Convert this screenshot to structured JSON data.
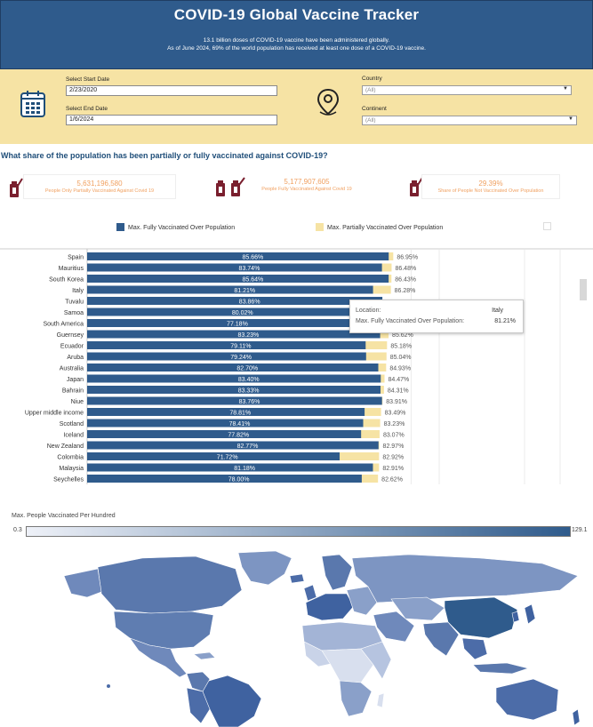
{
  "header": {
    "title": "COVID-19 Global Vaccine Tracker",
    "line1": "13.1 billion doses of COVID-19 vaccine have been administered globally.",
    "line2": "As of June 2024, 69% of the world population has received at least one dose of a COVID-19 vaccine."
  },
  "filters": {
    "start_label": "Select Start Date",
    "start_value": "2/23/2020",
    "end_label": "Select End Date",
    "end_value": "1/6/2024",
    "country_label": "Country",
    "country_value": "(All)",
    "continent_label": "Continent",
    "continent_value": "(All)"
  },
  "question": "What share of the population has been partially or fully vaccinated against COVID-19?",
  "kpis": [
    {
      "value": "5,631,196,580",
      "label": "People Only Partially Vaccinated Against Covid 19"
    },
    {
      "value": "5,177,907,605",
      "label": "People Fully Vaccinated Against Covid 19"
    },
    {
      "value": "29.39%",
      "label": "Share of People Not Vaccinated Over Population"
    }
  ],
  "legend": {
    "fully": "Max. Fully Vaccinated Over Population",
    "partial": "Max. Partially Vaccinated Over Population"
  },
  "colors": {
    "fully": "#2f5b8c",
    "partial": "#f6e3a4",
    "header": "#2f5b8c",
    "filters_bg": "#f6e3a4",
    "kpi_icon": "#7a1f2e"
  },
  "chart_data": {
    "type": "bar",
    "orientation": "horizontal",
    "stacked": false,
    "xlim": [
      0,
      100
    ],
    "categories": [
      "Spain",
      "Mauritius",
      "South Korea",
      "Italy",
      "Tuvalu",
      "Samoa",
      "South America",
      "Guernsey",
      "Ecuador",
      "Aruba",
      "Australia",
      "Japan",
      "Bahrain",
      "Niue",
      "Upper middle income",
      "Scotland",
      "Iceland",
      "New Zealand",
      "Colombia",
      "Malaysia",
      "Seychelles"
    ],
    "series": [
      {
        "name": "Max. Fully Vaccinated Over Population",
        "values": [
          85.66,
          83.74,
          85.64,
          81.21,
          83.86,
          80.02,
          77.18,
          83.23,
          79.11,
          79.24,
          82.7,
          83.4,
          83.33,
          83.76,
          78.81,
          78.41,
          77.82,
          82.77,
          71.72,
          81.18,
          78.0
        ]
      },
      {
        "name": "Max. Partially Vaccinated Over Population",
        "values": [
          86.95,
          86.48,
          86.43,
          86.28,
          null,
          null,
          null,
          85.62,
          85.18,
          85.04,
          84.93,
          84.47,
          84.31,
          83.91,
          83.49,
          83.23,
          83.07,
          82.97,
          82.92,
          82.91,
          82.62
        ]
      }
    ],
    "fully_labels": [
      "85.66%",
      "83.74%",
      "85.64%",
      "81.21%",
      "83.86%",
      "80.02%",
      "77.18%",
      "83.23%",
      "79.11%",
      "79.24%",
      "82.70%",
      "83.40%",
      "83.33%",
      "83.76%",
      "78.81%",
      "78.41%",
      "77.82%",
      "82.77%",
      "71.72%",
      "81.18%",
      "78.00%"
    ],
    "partial_labels": [
      "86.95%",
      "86.48%",
      "86.43%",
      "86.28%",
      "",
      "",
      "",
      "85.62%",
      "85.18%",
      "85.04%",
      "84.93%",
      "84.47%",
      "84.31%",
      "83.91%",
      "83.49%",
      "83.23%",
      "83.07%",
      "82.97%",
      "82.92%",
      "82.91%",
      "82.62%"
    ]
  },
  "tooltip": {
    "location_key": "Location:",
    "location_value": "Italy",
    "metric_key": "Max. Fully Vaccinated Over Population:",
    "metric_value": "81.21%"
  },
  "map": {
    "legend_title": "Max. People Vaccinated Per Hundred",
    "min": "0.3",
    "max": "129.1"
  }
}
